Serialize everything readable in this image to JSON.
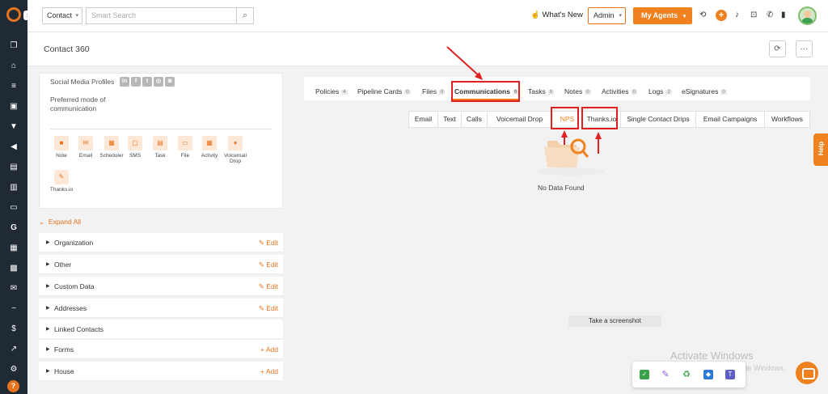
{
  "nav": {
    "contact_select": "Contact",
    "search_placeholder": "Smart Search",
    "whats_new": "What's New",
    "role_select": "Admin",
    "my_agents": "My Agents"
  },
  "header": {
    "title": "Contact 360"
  },
  "left_panel": {
    "social_media_label": "Social Media Profiles",
    "preferred_mode_label": "Preferred mode of communication",
    "actions": [
      {
        "label": "Note"
      },
      {
        "label": "Email"
      },
      {
        "label": "Scheduler"
      },
      {
        "label": "SMS"
      },
      {
        "label": "Task"
      },
      {
        "label": "File"
      },
      {
        "label": "Activity"
      },
      {
        "label": "Voicemail Drop"
      },
      {
        "label": "Thanks.io"
      }
    ],
    "expand_all": "Expand All",
    "sections": [
      {
        "name": "Organization",
        "action": "Edit"
      },
      {
        "name": "Other",
        "action": "Edit"
      },
      {
        "name": "Custom Data",
        "action": "Edit"
      },
      {
        "name": "Addresses",
        "action": "Edit"
      },
      {
        "name": "Linked Contacts",
        "action": ""
      },
      {
        "name": "Forms",
        "action": "Add"
      },
      {
        "name": "House",
        "action": "Add"
      }
    ]
  },
  "main_tabs": [
    {
      "label": "Policies",
      "count": "4"
    },
    {
      "label": "Pipeline Cards",
      "count": "0"
    },
    {
      "label": "Files",
      "count": "0"
    },
    {
      "label": "Communications",
      "count": "0"
    },
    {
      "label": "Tasks",
      "count": "0"
    },
    {
      "label": "Notes",
      "count": "0"
    },
    {
      "label": "Activities",
      "count": "0"
    },
    {
      "label": "Logs",
      "count": "2"
    },
    {
      "label": "eSignatures",
      "count": "0"
    }
  ],
  "sub_tabs": [
    {
      "label": "Email"
    },
    {
      "label": "Text"
    },
    {
      "label": "Calls"
    },
    {
      "label": "Voicemail Drop"
    },
    {
      "label": "NPS"
    },
    {
      "label": "Thanks.io"
    },
    {
      "label": "Single Contact Drips"
    },
    {
      "label": "Email Campaigns"
    },
    {
      "label": "Workflows"
    }
  ],
  "empty_state": "No Data Found",
  "screenshot_tip": "Take a screenshot",
  "watermark": {
    "line1": "Activate Windows",
    "line2": "Go to Settings to activate Windows."
  },
  "help_tab": "Help",
  "colors": {
    "accent": "#f0811f",
    "rail": "#1f2a35",
    "annotation": "#e02020"
  }
}
